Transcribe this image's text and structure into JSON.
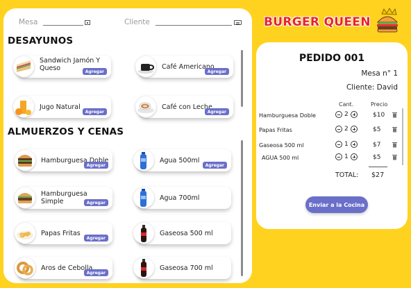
{
  "header": {
    "mesa_label": "Mesa",
    "cliente_label": "Cliente"
  },
  "brand": {
    "name": "BURGER QUEEN",
    "logo_icon": "burger-crown-icon"
  },
  "colors": {
    "background": "#FFD21F",
    "accent": "#6A6FC9",
    "brand_red": "#E8232E"
  },
  "menu": {
    "desayunos_title": "DESAYUNOS",
    "almuerzos_title": "ALMUERZOS Y CENAS",
    "add_label": "Agregar",
    "desayunos": [
      {
        "name": "Sandwich Jamón Y Queso",
        "icon": "sandwich-icon"
      },
      {
        "name": "Café Americano",
        "icon": "coffee-cup-icon"
      },
      {
        "name": "Jugo Natural",
        "icon": "orange-juice-icon"
      },
      {
        "name": "Café con Leche",
        "icon": "latte-icon"
      }
    ],
    "almuerzos": [
      {
        "name": "Hamburguesa Doble",
        "icon": "double-burger-icon"
      },
      {
        "name": "Agua 500ml",
        "icon": "water-bottle-icon"
      },
      {
        "name": "Hamburguesa Simple",
        "icon": "burger-icon"
      },
      {
        "name": "Agua 700ml",
        "icon": "water-bottle-icon"
      },
      {
        "name": "Papas Fritas",
        "icon": "fries-icon"
      },
      {
        "name": "Gaseosa 500 ml",
        "icon": "soda-bottle-icon"
      },
      {
        "name": "Aros de Cebolla",
        "icon": "onion-rings-icon"
      },
      {
        "name": "Gaseosa 700 ml",
        "icon": "soda-bottle-icon"
      }
    ]
  },
  "order": {
    "title": "PEDIDO 001",
    "mesa": "Mesa n° 1",
    "cliente": "Cliente: David",
    "qty_header": "Cant.",
    "price_header": "Precio",
    "items": [
      {
        "name": "Hamburguesa Doble",
        "qty": "2",
        "price": "$10"
      },
      {
        "name": "Papas Fritas",
        "qty": "2",
        "price": "$5"
      },
      {
        "name": "Gaseosa 500 ml",
        "qty": "1",
        "price": "$7"
      },
      {
        "name": "AGUA 500 ml",
        "qty": "1",
        "price": "$5"
      }
    ],
    "total_label": "TOTAL:",
    "total_value": "$27",
    "send_label": "Enviar a la Cocina"
  }
}
